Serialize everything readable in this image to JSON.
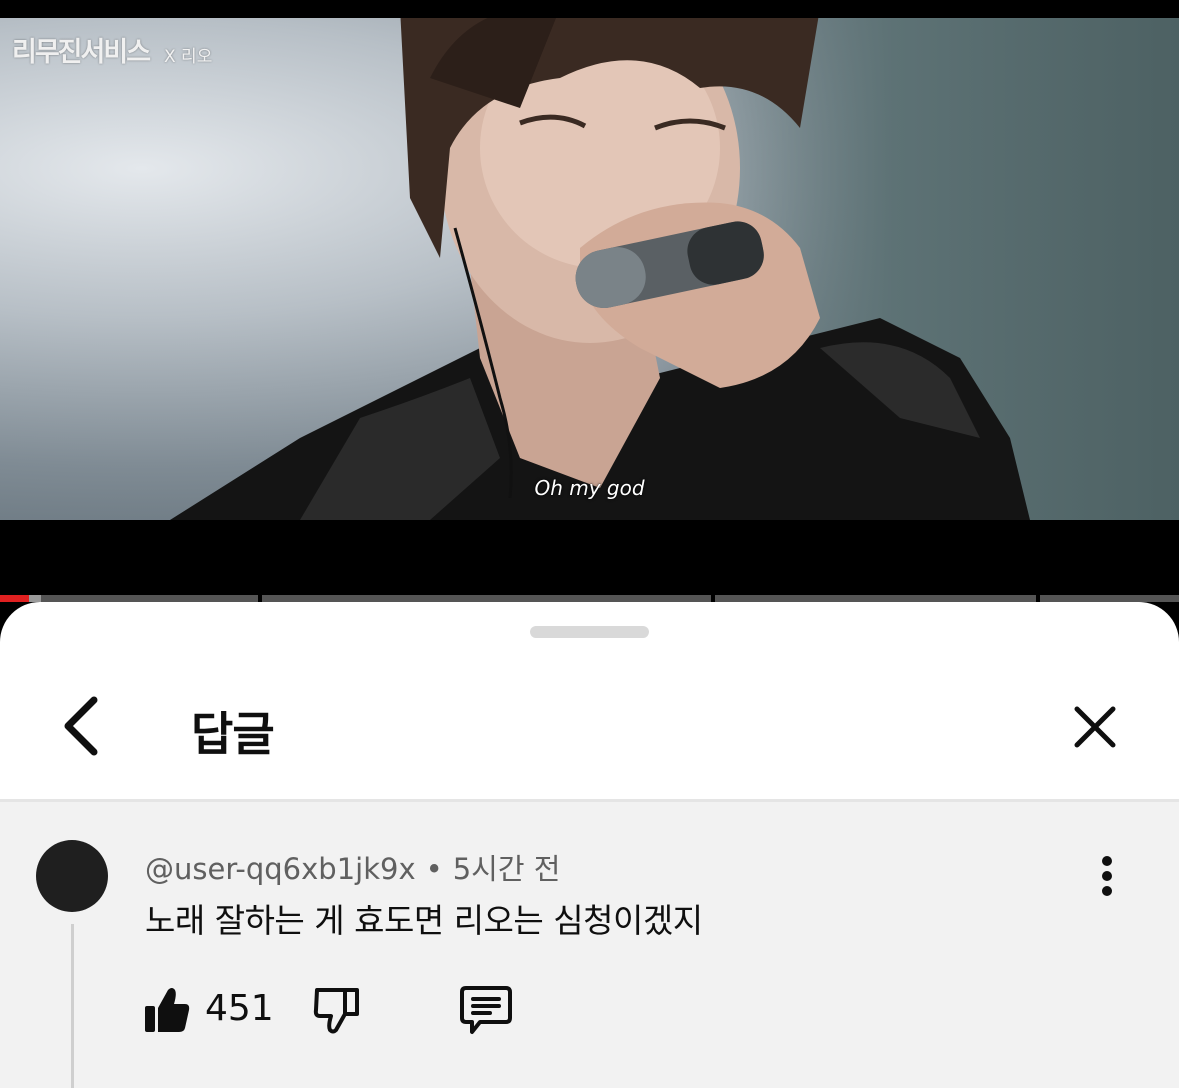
{
  "video": {
    "channel_logo": "리무진서비스",
    "collab_label": "X 리오",
    "subtitle": "Oh my god",
    "progress_fraction": 0.025
  },
  "sheet": {
    "title": "답글"
  },
  "comment": {
    "author": "@user-qq6xb1jk9x",
    "separator": "•",
    "time": "5시간 전",
    "text": "노래 잘하는 게 효도면 리오는 심청이겠지",
    "likes": "451"
  },
  "icons": {
    "back": "chevron-left-icon",
    "close": "close-icon",
    "more": "more-vertical-icon",
    "like": "thumbs-up-icon",
    "dislike": "thumbs-down-icon",
    "reply": "reply-comment-icon"
  },
  "colors": {
    "progress_played": "#e02020",
    "sheet_bg": "#ffffff",
    "comment_bg": "#f2f2f2",
    "text_primary": "#0f0f0f",
    "text_secondary": "#606060"
  }
}
